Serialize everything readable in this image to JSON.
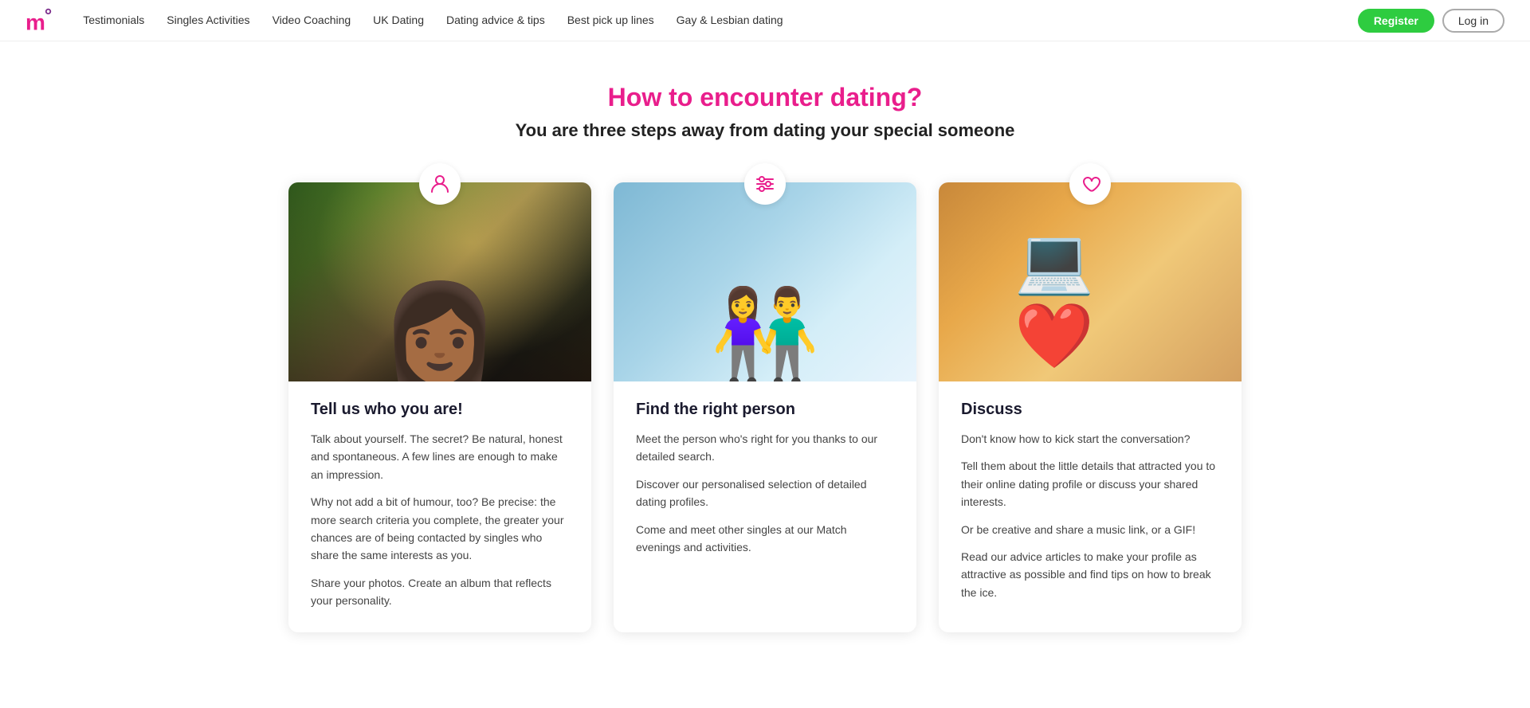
{
  "logo": {
    "letter": "m",
    "dot": "°"
  },
  "nav": {
    "links": [
      {
        "label": "Testimonials",
        "id": "testimonials"
      },
      {
        "label": "Singles Activities",
        "id": "singles-activities"
      },
      {
        "label": "Video Coaching",
        "id": "video-coaching"
      },
      {
        "label": "UK Dating",
        "id": "uk-dating"
      },
      {
        "label": "Dating advice & tips",
        "id": "dating-advice"
      },
      {
        "label": "Best pick up lines",
        "id": "pick-up-lines"
      },
      {
        "label": "Gay & Lesbian dating",
        "id": "gay-lesbian"
      }
    ],
    "register_label": "Register",
    "login_label": "Log in"
  },
  "hero": {
    "heading": "How to encounter dating?",
    "subheading": "You are three steps away from dating your special someone"
  },
  "cards": [
    {
      "id": "card-profile",
      "icon": "person",
      "title": "Tell us who you are!",
      "paragraphs": [
        "Talk about yourself. The secret? Be natural, honest and spontaneous. A few lines are enough to make an impression.",
        "Why not add a bit of humour, too? Be precise: the more search criteria you complete, the greater your chances are of being contacted by singles who share the same interests as you.",
        "Share your photos. Create an album that reflects your personality."
      ]
    },
    {
      "id": "card-search",
      "icon": "sliders",
      "title": "Find the right person",
      "paragraphs": [
        "Meet the person who's right for you thanks to our detailed search.",
        "Discover our personalised selection of detailed dating profiles.",
        "Come and meet other singles at our Match evenings and activities."
      ]
    },
    {
      "id": "card-discuss",
      "icon": "heart-chat",
      "title": "Discuss",
      "paragraphs": [
        "Don't know how to kick start the conversation?",
        "Tell them about the little details that attracted you to their online dating profile or discuss your shared interests.",
        "Or be creative and share a music link, or a GIF!",
        "Read our advice articles to make your profile as attractive as possible and find tips on how to break the ice."
      ]
    }
  ]
}
